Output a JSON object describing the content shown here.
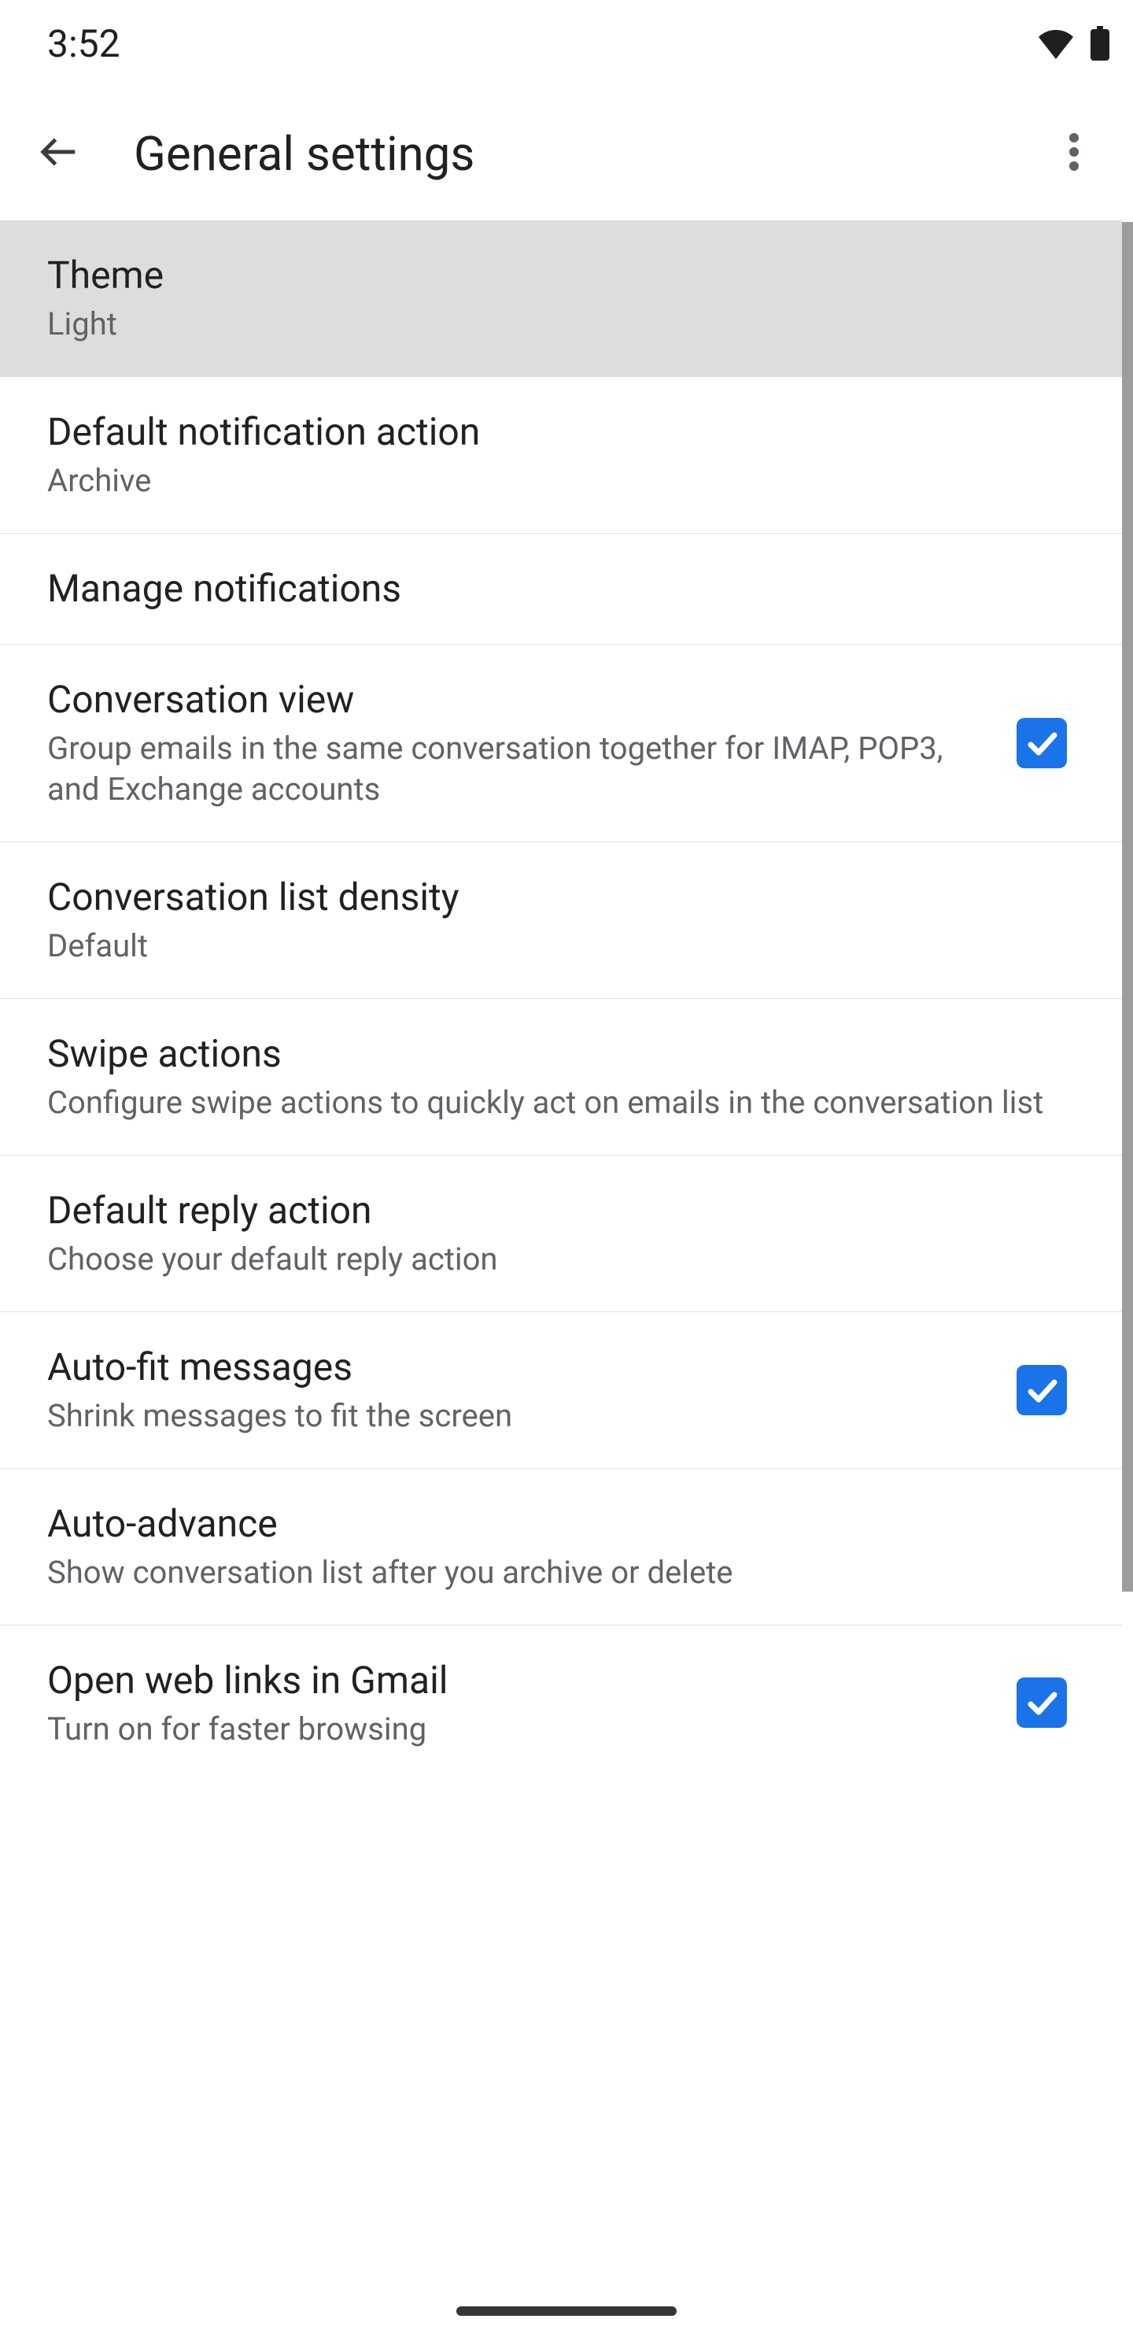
{
  "status": {
    "time": "3:52"
  },
  "appbar": {
    "title": "General settings"
  },
  "items": {
    "theme": {
      "title": "Theme",
      "sub": "Light"
    },
    "defaultNotif": {
      "title": "Default notification action",
      "sub": "Archive"
    },
    "manageNotif": {
      "title": "Manage notifications"
    },
    "convView": {
      "title": "Conversation view",
      "sub": "Group emails in the same conversation together for IMAP, POP3, and Exchange accounts",
      "checked": true
    },
    "density": {
      "title": "Conversation list density",
      "sub": "Default"
    },
    "swipe": {
      "title": "Swipe actions",
      "sub": "Configure swipe actions to quickly act on emails in the conversation list"
    },
    "reply": {
      "title": "Default reply action",
      "sub": "Choose your default reply action"
    },
    "autofit": {
      "title": "Auto-fit messages",
      "sub": "Shrink messages to fit the screen",
      "checked": true
    },
    "autoadv": {
      "title": "Auto-advance",
      "sub": "Show conversation list after you archive or delete"
    },
    "weblinks": {
      "title": "Open web links in Gmail",
      "sub": "Turn on for faster browsing",
      "checked": true
    }
  }
}
